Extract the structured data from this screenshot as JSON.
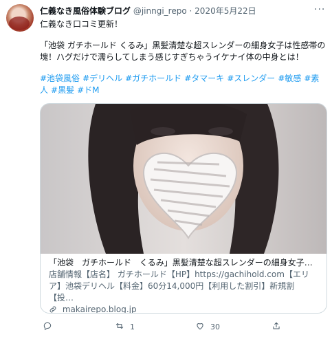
{
  "tweet": {
    "author_name": "仁義なき風俗体験ブログ",
    "handle": "@jinngi_repo",
    "separator": "·",
    "date": "2020年5月22日",
    "more_label": "···",
    "text_line1": "仁義なき口コミ更新！",
    "text_line2": "「池袋 ガチホールド くるみ」黒髪清楚な超スレンダーの細身女子は性感帯の塊！ハグだけで濡らしてしまう感じすぎちゃうイケナイ体の中身とは！",
    "hashtags": [
      "#池袋風俗",
      "#デリヘル",
      "#ガチホールド",
      "#タマーキ",
      "#スレンダー",
      "#敏感",
      "#素人",
      "#黒髪",
      "#ドM"
    ]
  },
  "card": {
    "title": "「池袋　ガチホールド　くるみ」黒髪清楚な超スレンダーの細身女子…",
    "description": "店舗情報【店名】 ガチホールド【HP】https://gachihold.com【エリア】池袋デリヘル【料金】60分14,000円【利用した割引】新規割【投…",
    "domain": "makairepo.blog.jp"
  },
  "actions": {
    "reply_count": "",
    "retweet_count": "1",
    "like_count": "30",
    "share_label": ""
  },
  "icons": {
    "reply": "reply-icon",
    "retweet": "retweet-icon",
    "like": "heart-icon",
    "share": "share-icon",
    "link": "link-icon"
  },
  "colors": {
    "hashtag": "#1d9bf0",
    "muted": "#536471",
    "border": "#cfd9de"
  }
}
